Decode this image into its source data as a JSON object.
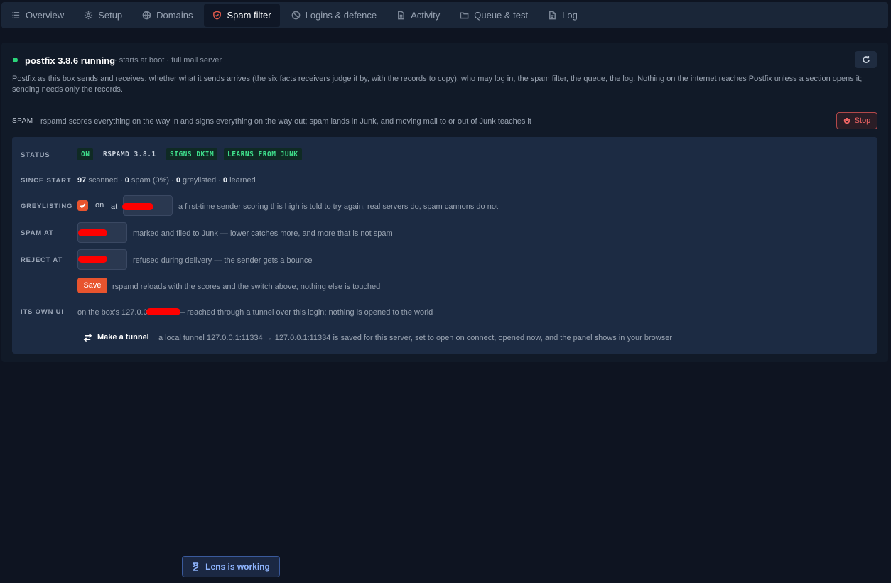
{
  "tabs": [
    {
      "label": "Overview",
      "icon": "list-icon"
    },
    {
      "label": "Setup",
      "icon": "gear-icon"
    },
    {
      "label": "Domains",
      "icon": "globe-icon"
    },
    {
      "label": "Spam filter",
      "icon": "shield-icon",
      "active": true
    },
    {
      "label": "Logins & defence",
      "icon": "ban-icon"
    },
    {
      "label": "Activity",
      "icon": "document-icon"
    },
    {
      "label": "Queue & test",
      "icon": "folder-icon"
    },
    {
      "label": "Log",
      "icon": "file-icon"
    }
  ],
  "service": {
    "name": "postfix 3.8.6 running",
    "meta": "· starts at boot · full mail server",
    "status_color": "#2bd47a",
    "description": "Postfix as this box sends and receives: whether what it sends arrives (the six facts receivers judge it by, with the records to copy), who may log in, the spam filter, the queue, the log. Nothing on the internet reaches Postfix unless a section opens it; sending needs only the records."
  },
  "spam": {
    "header": "SPAM",
    "description": "rspamd scores everything on the way in and signs everything on the way out; spam lands in Junk, and moving mail to or out of Junk teaches it",
    "stop_label": "Stop"
  },
  "status": {
    "label": "STATUS",
    "badges": [
      "ON",
      "RSPAMD 3.8.1",
      "SIGNS DKIM",
      "LEARNS FROM JUNK"
    ]
  },
  "since_start": {
    "label": "SINCE START",
    "scanned": "97",
    "scanned_text": "scanned ·",
    "spam": "0",
    "spam_text": "spam (0%) ·",
    "greylisted": "0",
    "greylisted_text": "greylisted ·",
    "learned": "0",
    "learned_text": "learned"
  },
  "greylisting": {
    "label": "GREYLISTING",
    "on_label": "on",
    "at_label": "at",
    "checked": true,
    "help": "a first-time sender scoring this high is told to try again; real servers do, spam cannons do not"
  },
  "spam_at": {
    "label": "SPAM AT",
    "help": "marked and filed to Junk — lower catches more, and more that is not spam"
  },
  "reject_at": {
    "label": "REJECT AT",
    "help": "refused during delivery — the sender gets a bounce"
  },
  "save": {
    "label": "Save",
    "help": "rspamd reloads with the scores and the switch above; nothing else is touched"
  },
  "own_ui": {
    "label": "ITS OWN UI",
    "text_before": "on the box's 127.0.0",
    "text_after": "– reached through a tunnel over this login; nothing is opened to the world",
    "tunnel_label": "Make a tunnel",
    "tunnel_help": "a local tunnel 127.0.0.1:11334 → 127.0.0.1:11334 is saved for this server, set to open on connect, opened now, and the panel shows in your browser"
  },
  "lens": {
    "label": "Lens is working"
  }
}
